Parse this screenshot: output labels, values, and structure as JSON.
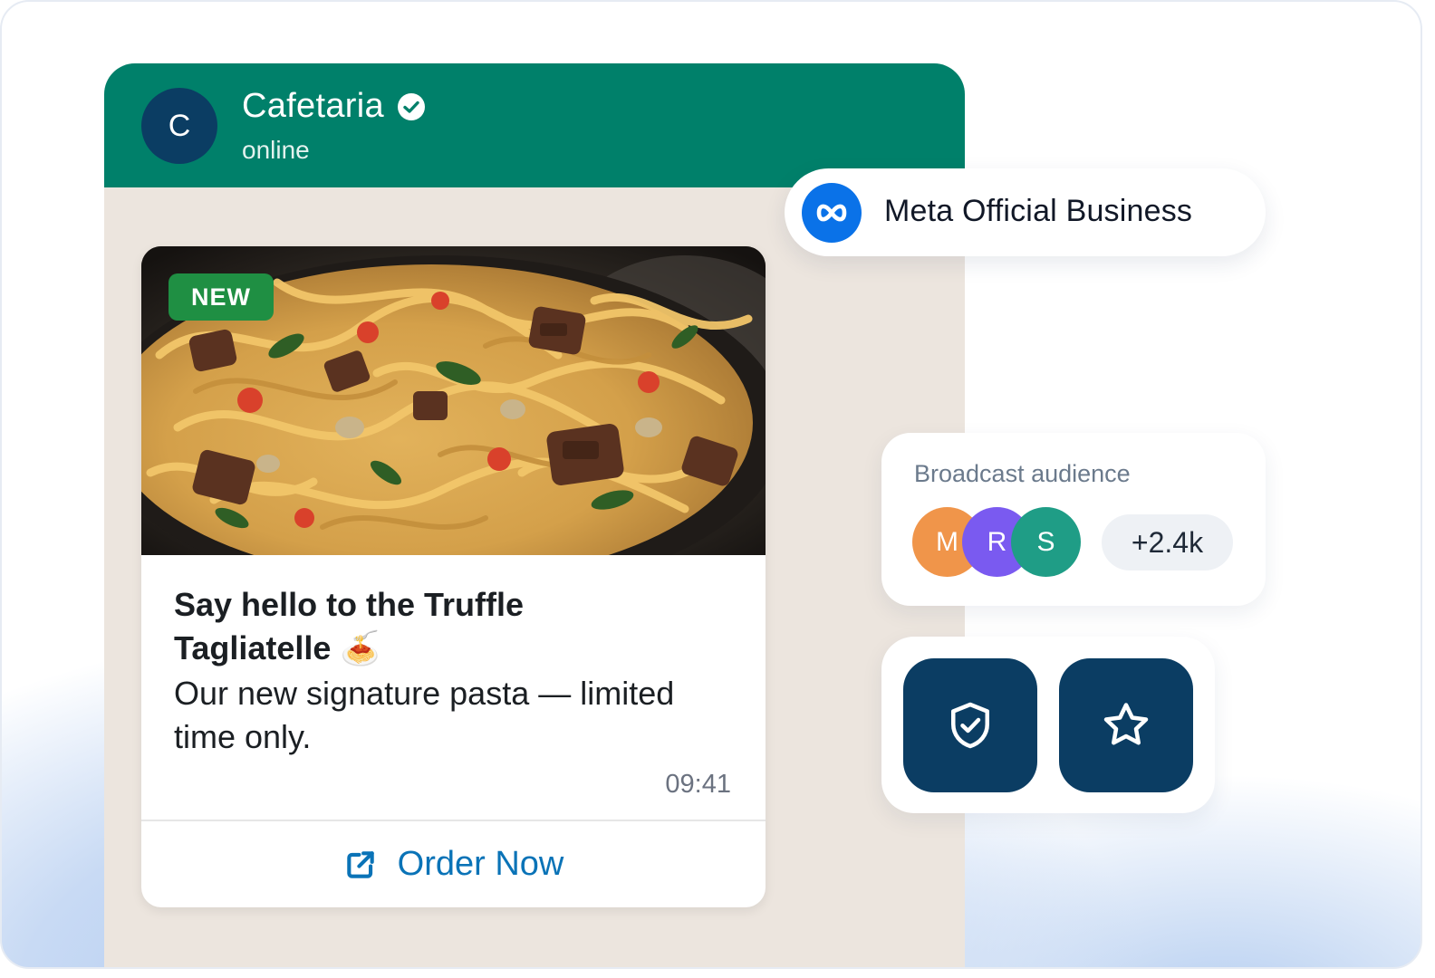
{
  "chat": {
    "avatar_letter": "C",
    "name": "Cafetaria",
    "status": "online",
    "verified_icon": "verified-check-icon"
  },
  "message": {
    "badge": "NEW",
    "title": "Say hello to the Truffle Tagliatelle 🍝",
    "body": "Our new signature pasta — limited time only.",
    "time": "09:41",
    "cta_label": "Order Now",
    "cta_icon": "external-link-icon"
  },
  "meta_badge": {
    "icon": "meta-logo-icon",
    "label": "Meta Official Business"
  },
  "audience": {
    "label": "Broadcast audience",
    "avatars": [
      {
        "letter": "M",
        "color": "#f0954a"
      },
      {
        "letter": "R",
        "color": "#7a5af0"
      },
      {
        "letter": "S",
        "color": "#1f9d86"
      }
    ],
    "count": "+2.4k"
  },
  "tiles": [
    {
      "icon": "shield-check-icon"
    },
    {
      "icon": "star-icon"
    }
  ],
  "colors": {
    "header_green": "#00806a",
    "navy": "#0b3d63",
    "link_blue": "#0a73b7",
    "badge_green": "#1f8f43",
    "meta_blue": "#0a72e8"
  }
}
